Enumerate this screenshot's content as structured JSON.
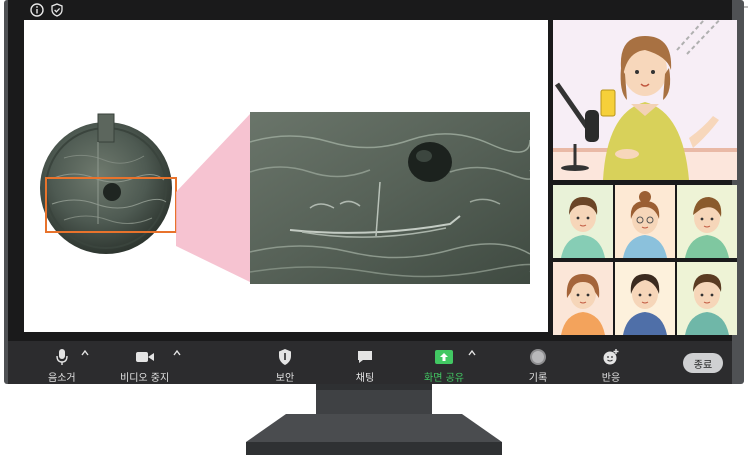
{
  "toolbar": {
    "mute_label": "음소거",
    "video_label": "비디오 중지",
    "security_label": "보안",
    "chat_label": "채팅",
    "share_label": "화면 공유",
    "record_label": "기록",
    "reactions_label": "반응",
    "end_label": "종료"
  },
  "colors": {
    "share_accent": "#42c863",
    "toolbar_bg": "#2c2c2e",
    "highlight_box": "#e8732c",
    "zoom_wedge": "#f4b8c9"
  },
  "icons": [
    "info-icon",
    "shield-check-icon",
    "microphone-icon",
    "video-camera-icon",
    "shield-icon",
    "chat-bubble-icon",
    "share-screen-icon",
    "record-icon",
    "reaction-icon",
    "caret-up-icon"
  ]
}
